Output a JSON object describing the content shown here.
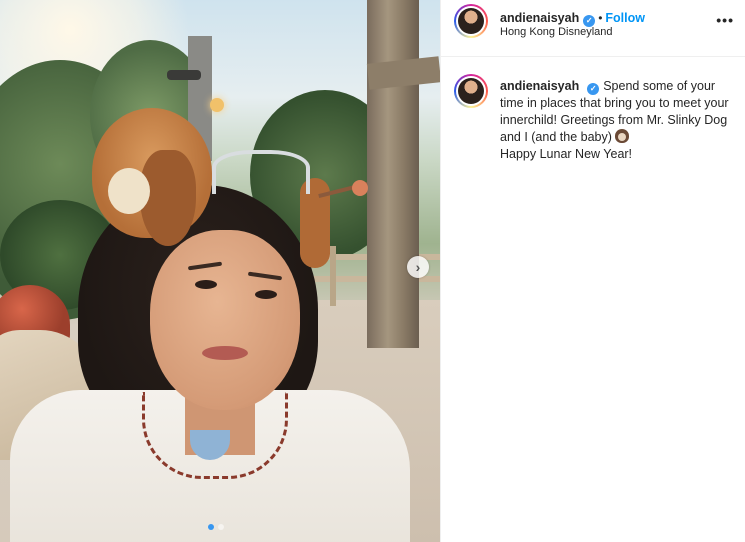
{
  "post": {
    "username": "andienaisyah",
    "follow_label": "Follow",
    "separator": "•",
    "location": "Hong Kong Disneyland",
    "more_label": "•••"
  },
  "caption": {
    "username": "andienaisyah",
    "text_before_emoji": "Spend some of your time in places that bring you to meet your innerchild! Greetings from Mr. Slinky Dog and I (and the baby)",
    "emoji": "dog-face",
    "text_after_emoji": "Happy Lunar New Year!"
  },
  "carousel": {
    "next_label": "›",
    "total_slides": 2,
    "active_index": 1
  },
  "colors": {
    "accent": "#0095f6",
    "verified": "#3897f0",
    "text": "#262626"
  }
}
